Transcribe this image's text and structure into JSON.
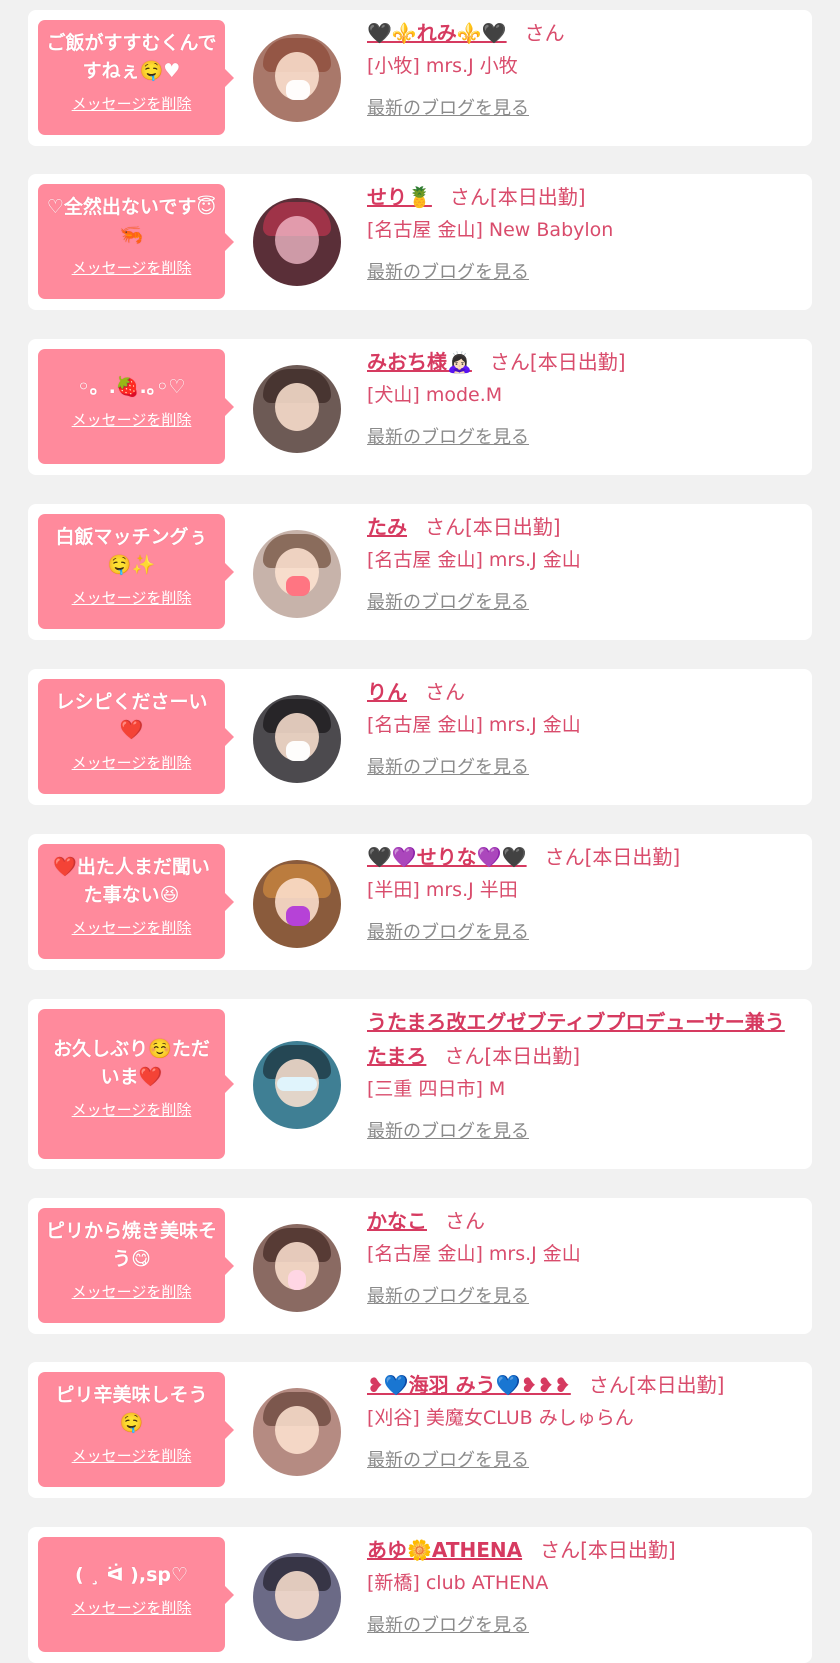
{
  "items": [
    {
      "message": "ご飯がすすむくんですねぇ🤤♥",
      "delete_label": "メッセージを削除",
      "name": "🖤⚜️れみ⚜️🖤",
      "suffix": "さん",
      "shop": "[小牧] mrs.J 小牧",
      "blog_label": "最新のブログを見る",
      "avatar_color": "#a9786a"
    },
    {
      "message": "♡全然出ないです😇🦐",
      "delete_label": "メッセージを削除",
      "name": "せり🍍",
      "suffix": "さん[本日出勤]",
      "shop": "[名古屋 金山] New Babylon",
      "blog_label": "最新のブログを見る",
      "avatar_color": "#5a2f38"
    },
    {
      "message": "◦。.🍓.｡◦♡",
      "delete_label": "メッセージを削除",
      "name": "みおち様🙇🏻‍♀️",
      "suffix": "さん[本日出勤]",
      "shop": "[犬山] mode.M",
      "blog_label": "最新のブログを見る",
      "avatar_color": "#6d5a55"
    },
    {
      "message": "白飯マッチングぅ🤤✨",
      "delete_label": "メッセージを削除",
      "name": "たみ",
      "suffix": "さん[本日出勤]",
      "shop": "[名古屋 金山] mrs.J 金山",
      "blog_label": "最新のブログを見る",
      "avatar_color": "#c7b3aa"
    },
    {
      "message": "レシピくださーい❤️",
      "delete_label": "メッセージを削除",
      "name": "りん",
      "suffix": "さん",
      "shop": "[名古屋 金山] mrs.J 金山",
      "blog_label": "最新のブログを見る",
      "avatar_color": "#4c4a4e"
    },
    {
      "message": "❤️出た人まだ聞いた事ない😆",
      "delete_label": "メッセージを削除",
      "name": "🖤💜せりな💜🖤",
      "suffix": "さん[本日出勤]",
      "shop": "[半田] mrs.J 半田",
      "blog_label": "最新のブログを見る",
      "avatar_color": "#8a5b3c"
    },
    {
      "message": "お久しぶり☺️ただいま❤️",
      "delete_label": "メッセージを削除",
      "name": "うたまろ改エグゼブティブプロデューサー兼うたまろ",
      "suffix": "さん[本日出勤]",
      "shop": "[三重 四日市] M",
      "blog_label": "最新のブログを見る",
      "avatar_color": "#3f7f94"
    },
    {
      "message": "ピリから焼き美味そう😋",
      "delete_label": "メッセージを削除",
      "name": "かなこ",
      "suffix": "さん",
      "shop": "[名古屋 金山] mrs.J 金山",
      "blog_label": "最新のブログを見る",
      "avatar_color": "#8a6a62"
    },
    {
      "message": "ピリ辛美味しそう🤤",
      "delete_label": "メッセージを削除",
      "name": "❥💙海羽 みう💙❥❥❥",
      "suffix": "さん[本日出勤]",
      "shop": "[刈谷] 美魔女CLUB みしゅらん",
      "blog_label": "最新のブログを見る",
      "avatar_color": "#b58b82"
    },
    {
      "message": "( ¸ ᐛ ),sp♡",
      "delete_label": "メッセージを削除",
      "name": "あゆ🌼ATHENA",
      "suffix": "さん[本日出勤]",
      "shop": "[新橋] club ATHENA",
      "blog_label": "最新のブログを見る",
      "avatar_color": "#6b6a86"
    }
  ]
}
